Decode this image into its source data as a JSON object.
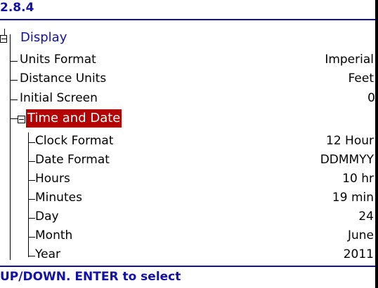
{
  "header": {
    "version": "2.8.4"
  },
  "tree": {
    "section_display": "Display",
    "display_items": [
      {
        "label": "Units Format",
        "value": "Imperial"
      },
      {
        "label": "Distance Units",
        "value": "Feet"
      },
      {
        "label": "Initial Screen",
        "value": "0"
      }
    ],
    "section_time": "Time and Date",
    "time_items": [
      {
        "label": "Clock Format",
        "value": "12 Hour"
      },
      {
        "label": "Date Format",
        "value": "DDMMYY"
      },
      {
        "label": "Hours",
        "value": "10 hr"
      },
      {
        "label": "Minutes",
        "value": "19 min"
      },
      {
        "label": "Day",
        "value": "24"
      },
      {
        "label": "Month",
        "value": "June"
      },
      {
        "label": "Year",
        "value": "2011"
      }
    ]
  },
  "footer": {
    "hint": "UP/DOWN. ENTER to select"
  },
  "colors": {
    "accent": "#1111aa",
    "selected_bg": "#b30000"
  }
}
